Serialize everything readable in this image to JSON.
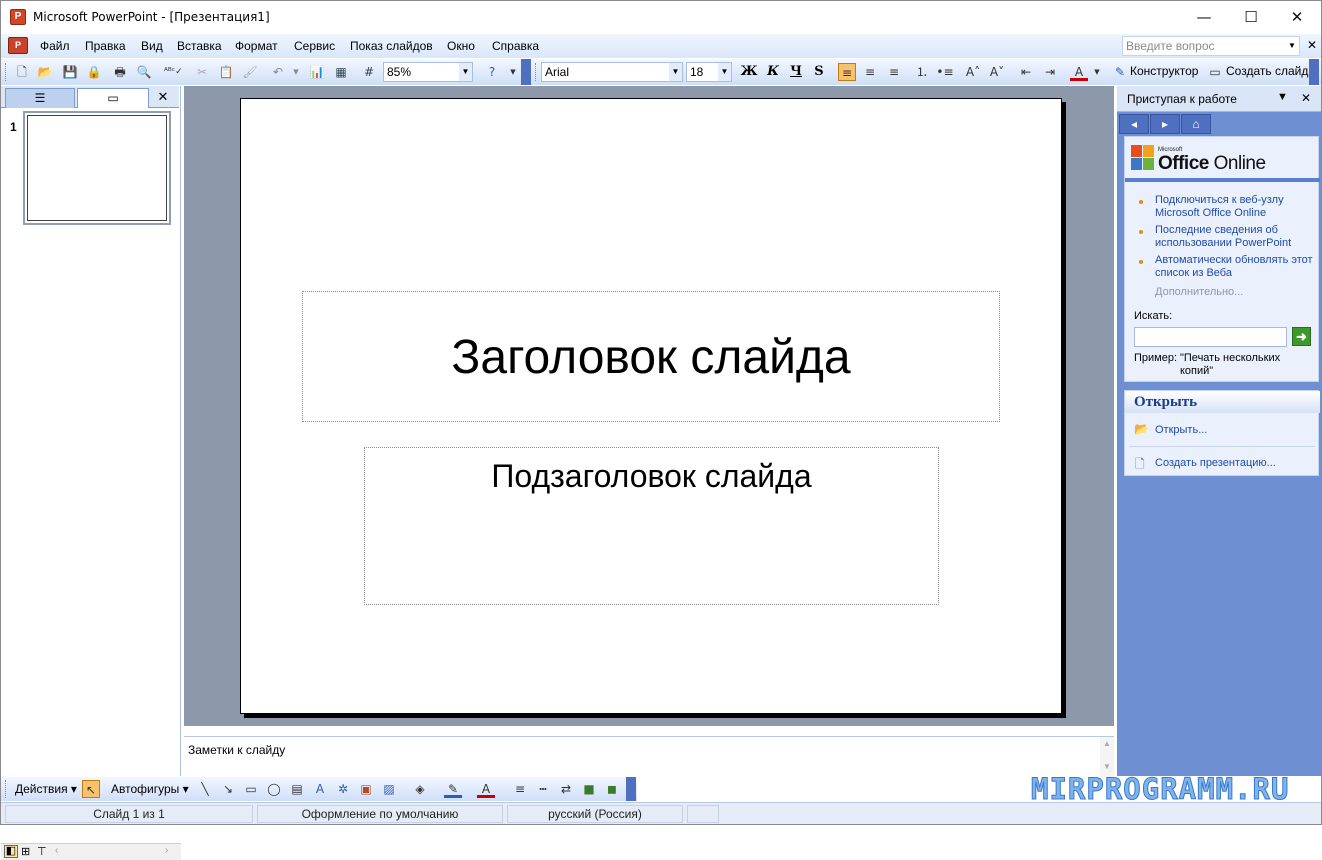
{
  "window": {
    "title": "Microsoft PowerPoint - [Презентация1]",
    "app_icon_label": "P",
    "minimize": "—",
    "maximize": "☐",
    "close": "✕"
  },
  "menu": {
    "items": [
      "Файл",
      "Правка",
      "Вид",
      "Вставка",
      "Формат",
      "Сервис",
      "Показ слайдов",
      "Окно",
      "Справка"
    ],
    "help_placeholder": "Введите вопрос",
    "close_doc": "✕"
  },
  "toolbar": {
    "zoom": "85%",
    "font": "Arial",
    "font_size": "18",
    "bold": "Ж",
    "italic": "К",
    "underline": "Ч",
    "shadow": "S",
    "designer": "Конструктор",
    "new_slide": "Создать слайд"
  },
  "left_pane": {
    "slide_number": "1",
    "close": "✕"
  },
  "slide": {
    "title": "Заголовок слайда",
    "subtitle": "Подзаголовок слайда"
  },
  "notes": {
    "placeholder": "Заметки к слайду"
  },
  "task_pane": {
    "title": "Приступая к работе",
    "logo_small": "Microsoft",
    "logo_office": "Office",
    "logo_online": "Online",
    "links": [
      "Подключиться к веб-узлу Microsoft Office Online",
      "Последние сведения об использовании PowerPoint",
      "Автоматически обновлять этот список из Веба"
    ],
    "more": "Дополнительно...",
    "search_label": "Искать:",
    "example_label": "Пример:",
    "example_value": "\"Печать нескольких копий\"",
    "open_header": "Открыть",
    "open_link": "Открыть...",
    "create_link": "Создать презентацию..."
  },
  "draw_toolbar": {
    "actions": "Действия",
    "autoshapes": "Автофигуры"
  },
  "watermark": "MIRPROGRAMM.RU",
  "status": {
    "slide": "Слайд 1 из 1",
    "design": "Оформление по умолчанию",
    "language": "русский (Россия)"
  }
}
